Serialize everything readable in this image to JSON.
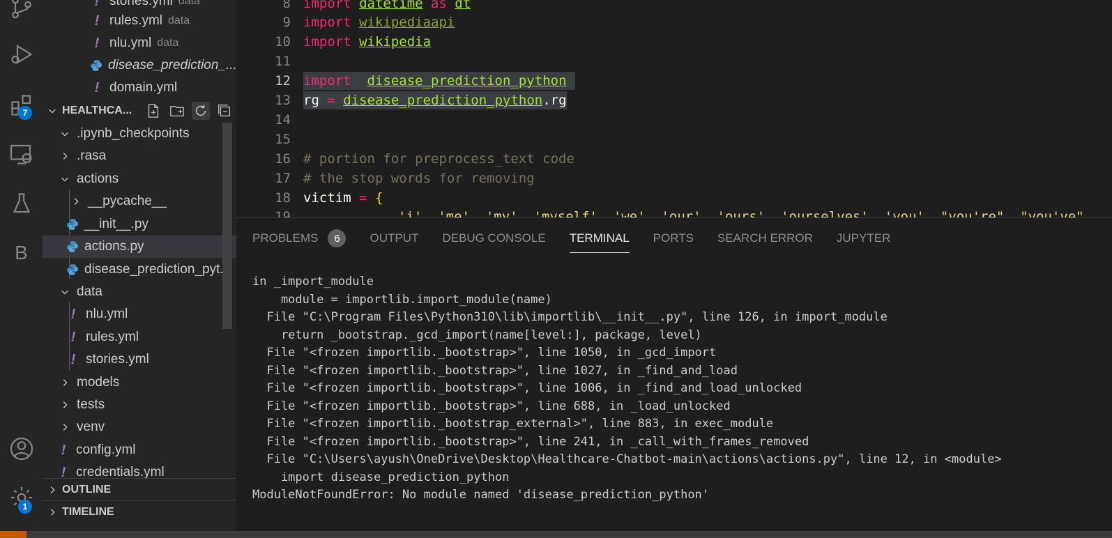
{
  "activity": {
    "extensions_badge": "7",
    "settings_badge": "1",
    "items": [
      "source-control-icon",
      "run-debug-icon",
      "extensions-icon",
      "remote-explorer-icon",
      "testing-icon",
      "b-extension-icon",
      "accounts-icon",
      "settings-gear-icon"
    ],
    "b_label": "B"
  },
  "sidebar": {
    "open_editors": [
      {
        "name": "stories.yml",
        "desc": "data",
        "type": "yml"
      },
      {
        "name": "rules.yml",
        "desc": "data",
        "type": "yml"
      },
      {
        "name": "nlu.yml",
        "desc": "data",
        "type": "yml"
      },
      {
        "name": "disease_prediction_...",
        "desc": "",
        "type": "py"
      },
      {
        "name": "domain.yml",
        "desc": "",
        "type": "yml"
      }
    ],
    "workspace_title": "HEALTHCA...",
    "tree": [
      {
        "name": ".ipynb_checkpoints",
        "kind": "folder-open",
        "level": 0
      },
      {
        "name": ".rasa",
        "kind": "folder",
        "level": 0
      },
      {
        "name": "actions",
        "kind": "folder-open",
        "level": 0
      },
      {
        "name": "__pycache__",
        "kind": "folder",
        "level": 1
      },
      {
        "name": "__init__.py",
        "kind": "py",
        "level": 1
      },
      {
        "name": "actions.py",
        "kind": "py",
        "level": 1,
        "selected": true
      },
      {
        "name": "disease_prediction_pyt...",
        "kind": "py",
        "level": 1
      },
      {
        "name": "data",
        "kind": "folder-open",
        "level": 0
      },
      {
        "name": "nlu.yml",
        "kind": "yml",
        "level": 1
      },
      {
        "name": "rules.yml",
        "kind": "yml",
        "level": 1
      },
      {
        "name": "stories.yml",
        "kind": "yml",
        "level": 1
      },
      {
        "name": "models",
        "kind": "folder",
        "level": 0
      },
      {
        "name": "tests",
        "kind": "folder",
        "level": 0
      },
      {
        "name": "venv",
        "kind": "folder",
        "level": 0
      },
      {
        "name": "config.yml",
        "kind": "yml",
        "level": 0
      },
      {
        "name": "credentials.yml",
        "kind": "yml",
        "level": 0
      }
    ],
    "outline": "OUTLINE",
    "timeline": "TIMELINE"
  },
  "editor": {
    "lines": [
      {
        "n": "8",
        "kw": "import",
        "mod": "datetime",
        "rest": " as ",
        "alias": "dt"
      },
      {
        "n": "9",
        "kw": "import",
        "mod": "wikipediaapi"
      },
      {
        "n": "10",
        "kw": "import",
        "mod": "wikipedia"
      },
      {
        "n": "11"
      },
      {
        "n": "12",
        "kw": "import",
        "mod": "disease_prediction_python",
        "highlight": true
      },
      {
        "n": "13",
        "text1": "rg ",
        "op": "=",
        "mod": "disease_prediction_python",
        "text2": ".rg",
        "highlight": true
      },
      {
        "n": "14"
      },
      {
        "n": "15"
      },
      {
        "n": "16",
        "comment": "# portion for preprocess_text code"
      },
      {
        "n": "17",
        "comment": "# the stop words for removing"
      },
      {
        "n": "18",
        "text1": "victim ",
        "op": "=",
        "text2": " {"
      },
      {
        "n": "19",
        "strings": "'i', 'me', 'my', 'myself', 'we', 'our', 'ours', 'ourselves', 'you', \"you're\", \"you've\""
      }
    ]
  },
  "panel": {
    "tabs": [
      "PROBLEMS",
      "OUTPUT",
      "DEBUG CONSOLE",
      "TERMINAL",
      "PORTS",
      "SEARCH ERROR",
      "JUPYTER"
    ],
    "problems_count": "6",
    "active_tab": "TERMINAL",
    "terminal_lines": [
      "in _import_module",
      "    module = importlib.import_module(name)",
      "  File \"C:\\Program Files\\Python310\\lib\\importlib\\__init__.py\", line 126, in import_module",
      "    return _bootstrap._gcd_import(name[level:], package, level)",
      "  File \"<frozen importlib._bootstrap>\", line 1050, in _gcd_import",
      "  File \"<frozen importlib._bootstrap>\", line 1027, in _find_and_load",
      "  File \"<frozen importlib._bootstrap>\", line 1006, in _find_and_load_unlocked",
      "  File \"<frozen importlib._bootstrap>\", line 688, in _load_unlocked",
      "  File \"<frozen importlib._bootstrap_external>\", line 883, in exec_module",
      "  File \"<frozen importlib._bootstrap>\", line 241, in _call_with_frames_removed",
      "  File \"C:\\Users\\ayush\\OneDrive\\Desktop\\Healthcare-Chatbot-main\\actions\\actions.py\", line 12, in <module>",
      "    import disease_prediction_python",
      "ModuleNotFoundError: No module named 'disease_prediction_python'"
    ]
  }
}
